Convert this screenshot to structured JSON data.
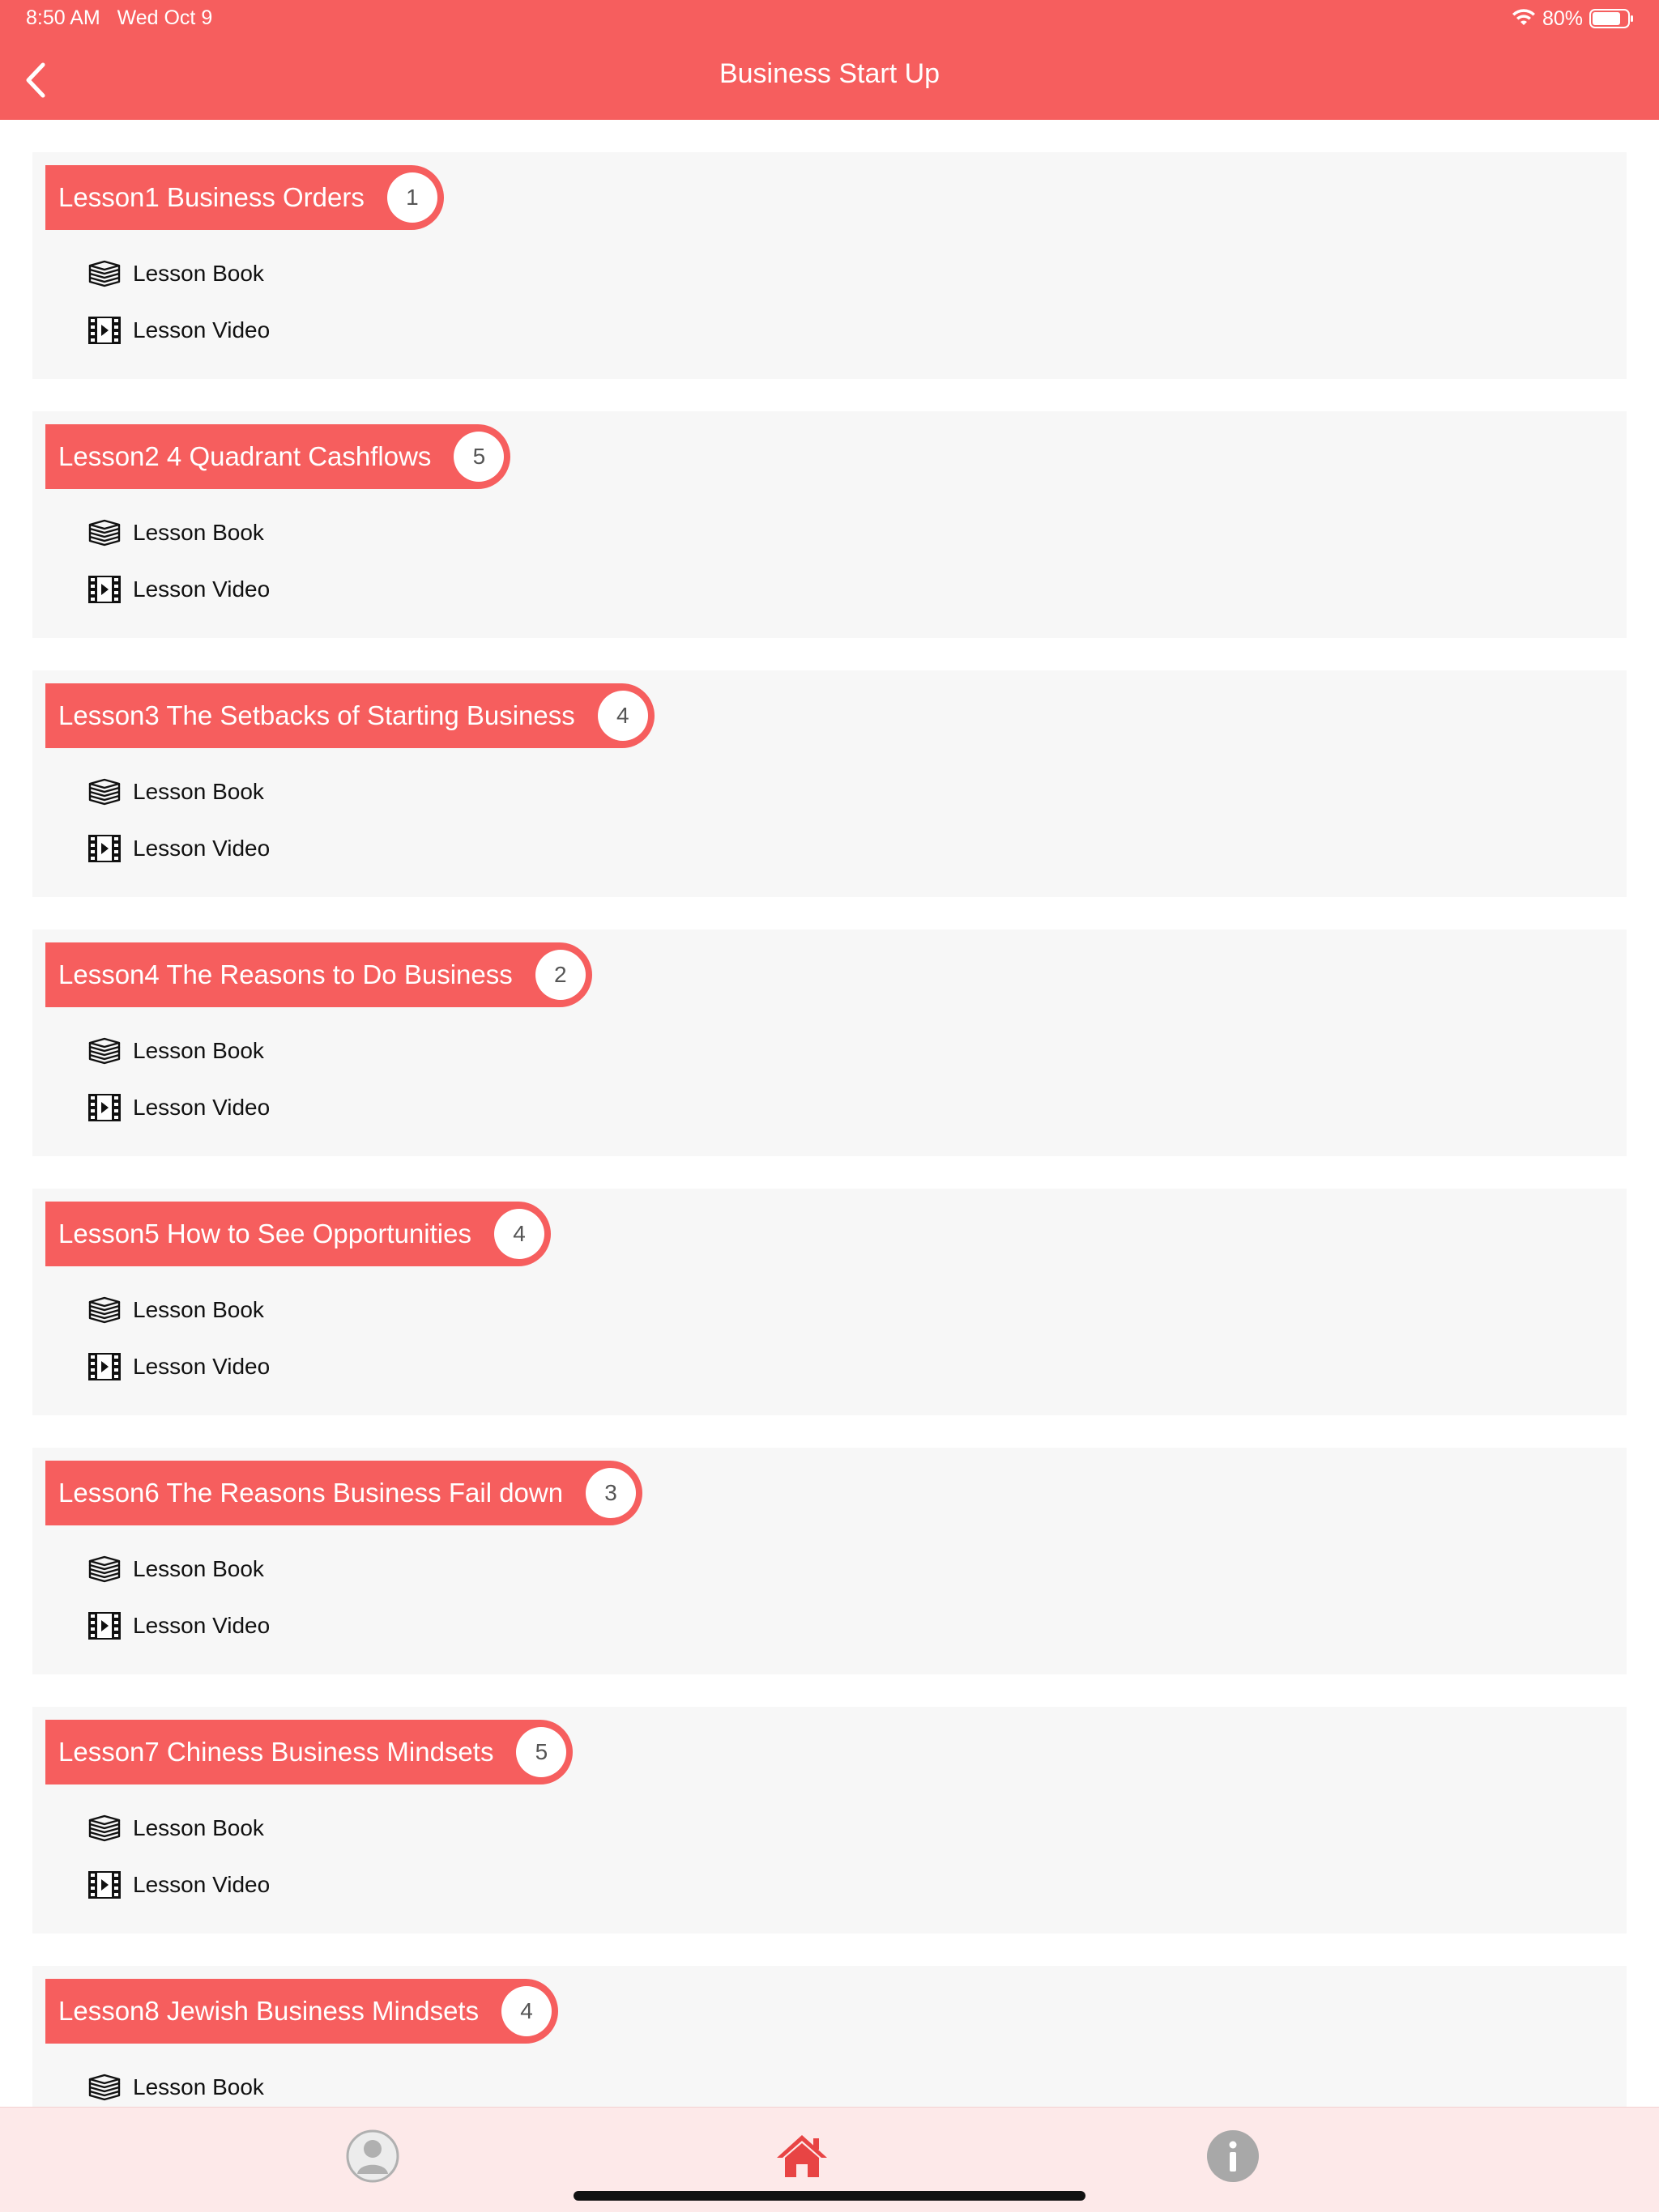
{
  "status_bar": {
    "time": "8:50 AM",
    "date": "Wed Oct 9",
    "battery": "80%"
  },
  "nav": {
    "title": "Business Start Up"
  },
  "item_labels": {
    "book": "Lesson Book",
    "video": "Lesson Video"
  },
  "lessons": [
    {
      "title": "Lesson1 Business Orders",
      "count": "1"
    },
    {
      "title": "Lesson2 4 Quadrant Cashflows",
      "count": "5"
    },
    {
      "title": "Lesson3 The Setbacks of Starting Business",
      "count": "4"
    },
    {
      "title": "Lesson4 The Reasons to Do Business",
      "count": "2"
    },
    {
      "title": "Lesson5 How to See Opportunities",
      "count": "4"
    },
    {
      "title": "Lesson6 The Reasons Business Fail down",
      "count": "3"
    },
    {
      "title": "Lesson7 Chiness Business Mindsets",
      "count": "5"
    },
    {
      "title": "Lesson8 Jewish Business Mindsets",
      "count": "4"
    }
  ],
  "tabbar": {
    "tabs": [
      {
        "icon": "profile-icon",
        "active": false
      },
      {
        "icon": "home-icon",
        "active": true
      },
      {
        "icon": "info-icon",
        "active": false
      }
    ]
  },
  "colors": {
    "accent": "#f65e5e",
    "card_bg": "#f7f7f7",
    "tabbar_bg": "#fde9e9",
    "inactive_icon": "#b0b0b0",
    "active_icon": "#e84444"
  }
}
